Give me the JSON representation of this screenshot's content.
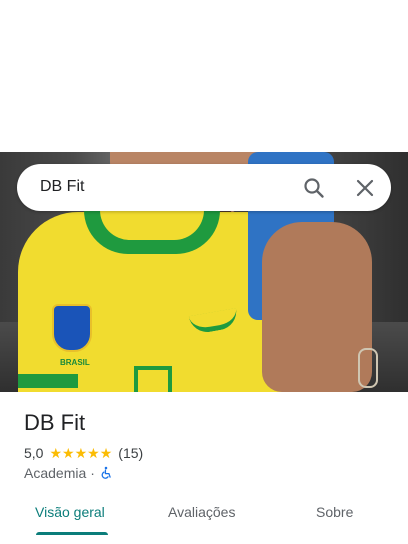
{
  "search": {
    "query": "DB Fit"
  },
  "place": {
    "name": "DB Fit",
    "rating": "5,0",
    "stars": [
      "★",
      "★",
      "★",
      "★",
      "★"
    ],
    "review_count": "(15)",
    "category": "Academia",
    "separator": "·",
    "accessibility_icon": "wheelchair-icon"
  },
  "hero": {
    "crest_text": "BRASIL"
  },
  "tabs": [
    {
      "label": "Visão geral",
      "active": true
    },
    {
      "label": "Avaliações",
      "active": false
    },
    {
      "label": "Sobre",
      "active": false
    }
  ],
  "colors": {
    "accent": "#0b7d7a",
    "star": "#fbbc04",
    "title_text": "#202124",
    "secondary_text": "#5f6368",
    "accessibility_blue": "#1a73e8"
  }
}
